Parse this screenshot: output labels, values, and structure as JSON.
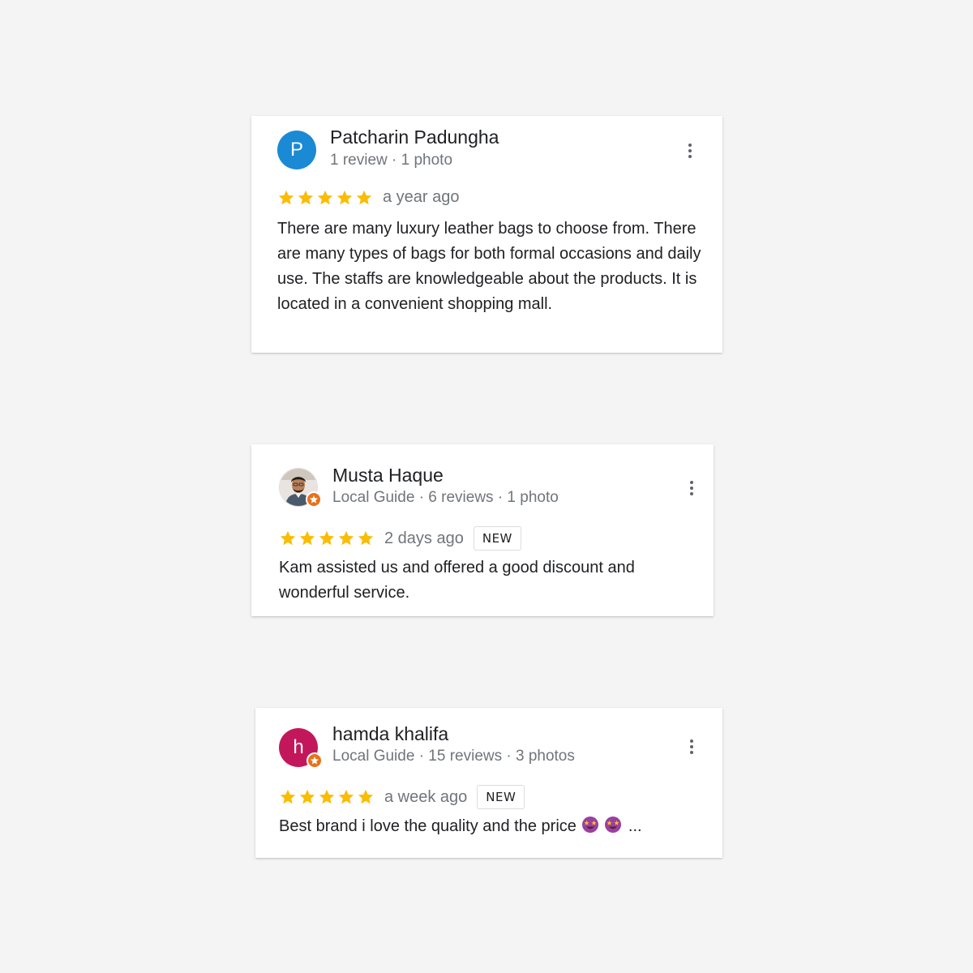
{
  "colors": {
    "page_bg": "#f4f4f4",
    "card_bg": "#ffffff",
    "star": "#fbbc04",
    "avatar_blue": "#1a8ad4",
    "avatar_pink": "#c2185b",
    "local_guide_orange": "#e8711a",
    "meta_text": "#70757a"
  },
  "reviews": [
    {
      "avatar_letter": "P",
      "name": "Patcharin Padungha",
      "meta": "1 review · 1 photo",
      "rating": 5,
      "when": "a year ago",
      "badge": "",
      "text": "There are many luxury leather bags to choose from. There are many types of bags for both formal occasions and daily use. The staffs are knowledgeable about the products. It is located in a convenient shopping mall."
    },
    {
      "avatar_letter": "",
      "avatar_type": "photo",
      "name": "Musta Haque",
      "meta": "Local Guide · 6 reviews · 1 photo",
      "rating": 5,
      "when": "2 days ago",
      "badge": "NEW",
      "text": "Kam assisted us and offered a good discount and wonderful service."
    },
    {
      "avatar_letter": "h",
      "name": "hamda khalifa",
      "meta": "Local Guide · 15 reviews · 3 photos",
      "rating": 5,
      "when": "a week ago",
      "badge": "NEW",
      "text": "Best brand i love the quality and the price",
      "emoji_icons": [
        "star-struck-emoji",
        "star-struck-emoji"
      ],
      "ellipsis": "..."
    }
  ]
}
